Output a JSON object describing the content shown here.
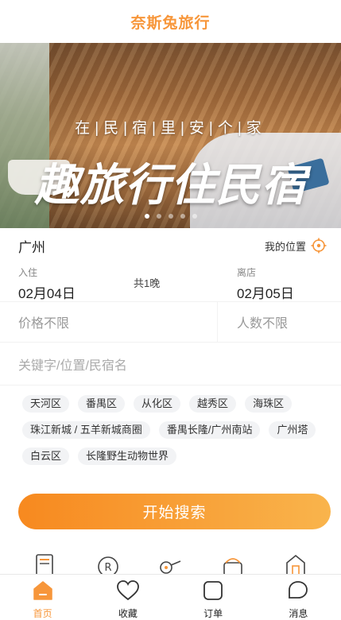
{
  "app": {
    "title": "奈斯兔旅行",
    "accent": "#f7963a"
  },
  "banner": {
    "tagline": "在|民|宿|里|安|个|家",
    "headline": "趣旅行住民宿",
    "dots_total": 5,
    "dots_active": 1
  },
  "location": {
    "city": "广州",
    "my_location_label": "我的位置"
  },
  "dates": {
    "checkin_label": "入住",
    "checkin_value": "02月04日",
    "nights": "共1晚",
    "checkout_label": "离店",
    "checkout_value": "02月05日"
  },
  "filters": {
    "price": "价格不限",
    "people": "人数不限"
  },
  "keyword": {
    "placeholder": "关键字/位置/民宿名"
  },
  "tags": [
    "天河区",
    "番禺区",
    "从化区",
    "越秀区",
    "海珠区",
    "珠江新城 / 五羊新城商圈",
    "番禺长隆/广州南站",
    "广州塔",
    "白云区",
    "长隆野生动物世界"
  ],
  "search_button": "开始搜索",
  "tabbar": [
    {
      "label": "首页",
      "icon": "home-icon",
      "active": true
    },
    {
      "label": "收藏",
      "icon": "heart-icon",
      "active": false
    },
    {
      "label": "订单",
      "icon": "order-icon",
      "active": false
    },
    {
      "label": "消息",
      "icon": "message-icon",
      "active": false
    }
  ]
}
